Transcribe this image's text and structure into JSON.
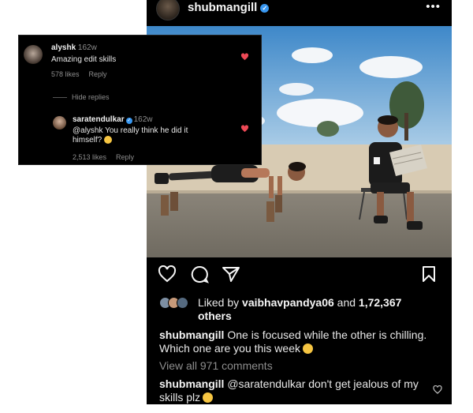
{
  "post": {
    "username": "shubmangill",
    "likes": {
      "prefix": "Liked by ",
      "liker": "vaibhavpandya06",
      "middle": " and ",
      "count": "1,72,367",
      "others": "others"
    },
    "caption": {
      "username": "shubmangill",
      "text": " One is focused while the other is chilling. Which one are you this week"
    },
    "view_all_comments": "View all 971 comments",
    "top_comment": {
      "username": "shubmangill",
      "text": " @saratendulkar don't get jealous of my skills plz"
    }
  },
  "overlay": {
    "comment1": {
      "username": "alyshk",
      "time": "162w",
      "text": "Amazing edit skills",
      "likes": "578 likes",
      "reply": "Reply"
    },
    "hide_replies": "Hide replies",
    "comment2": {
      "username": "saratendulkar",
      "time": "162w",
      "text": "@alyshk You really think he did it himself?",
      "likes": "2,513 likes",
      "reply": "Reply"
    }
  },
  "colors": {
    "background": "#000000",
    "heart_red": "#ed4956",
    "verified_blue": "#3897f0",
    "muted_text": "#8e8e8e"
  },
  "icons": [
    "verified-icon",
    "more-icon",
    "heart-icon",
    "comment-icon",
    "share-icon",
    "bookmark-icon"
  ]
}
